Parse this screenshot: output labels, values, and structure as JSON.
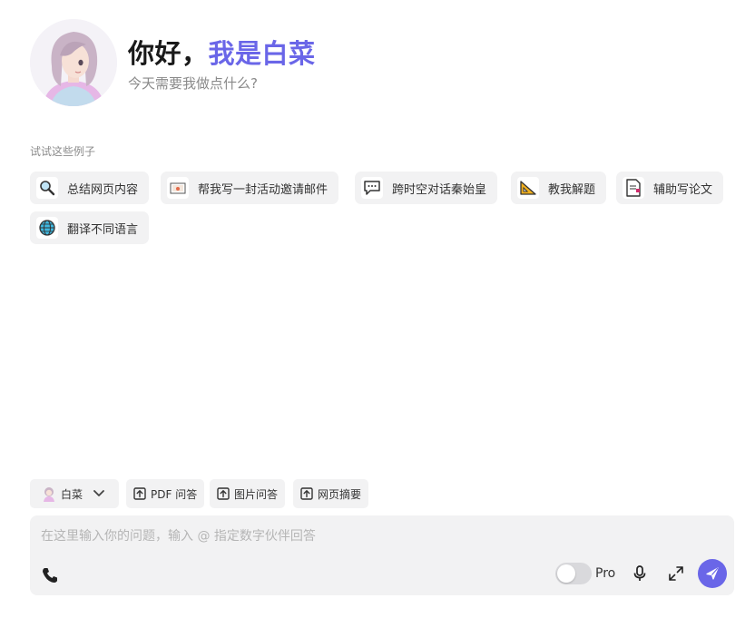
{
  "header": {
    "greeting_prefix": "你好，",
    "greeting_name": "我是白菜",
    "subtitle": "今天需要我做点什么?"
  },
  "examples": {
    "label": "试试这些例子",
    "chips": [
      {
        "label": "总结网页内容",
        "icon": "magnifier-icon"
      },
      {
        "label": "帮我写一封活动邀请邮件",
        "icon": "envelope-icon"
      },
      {
        "label": "跨时空对话秦始皇",
        "icon": "speech-bubble-icon"
      },
      {
        "label": "教我解题",
        "icon": "triangle-ruler-icon"
      },
      {
        "label": "辅助写论文",
        "icon": "document-icon"
      },
      {
        "label": "翻译不同语言",
        "icon": "globe-icon"
      }
    ]
  },
  "toolbar": {
    "persona_label": "白菜",
    "pdf_label": "PDF 问答",
    "image_label": "图片问答",
    "web_label": "网页摘要"
  },
  "input": {
    "placeholder": "在这里输入你的问题，输入 @ 指定数字伙伴回答",
    "pro_label": "Pro"
  },
  "colors": {
    "accent": "#6a66e8",
    "chip_bg": "#f2f2f3"
  }
}
